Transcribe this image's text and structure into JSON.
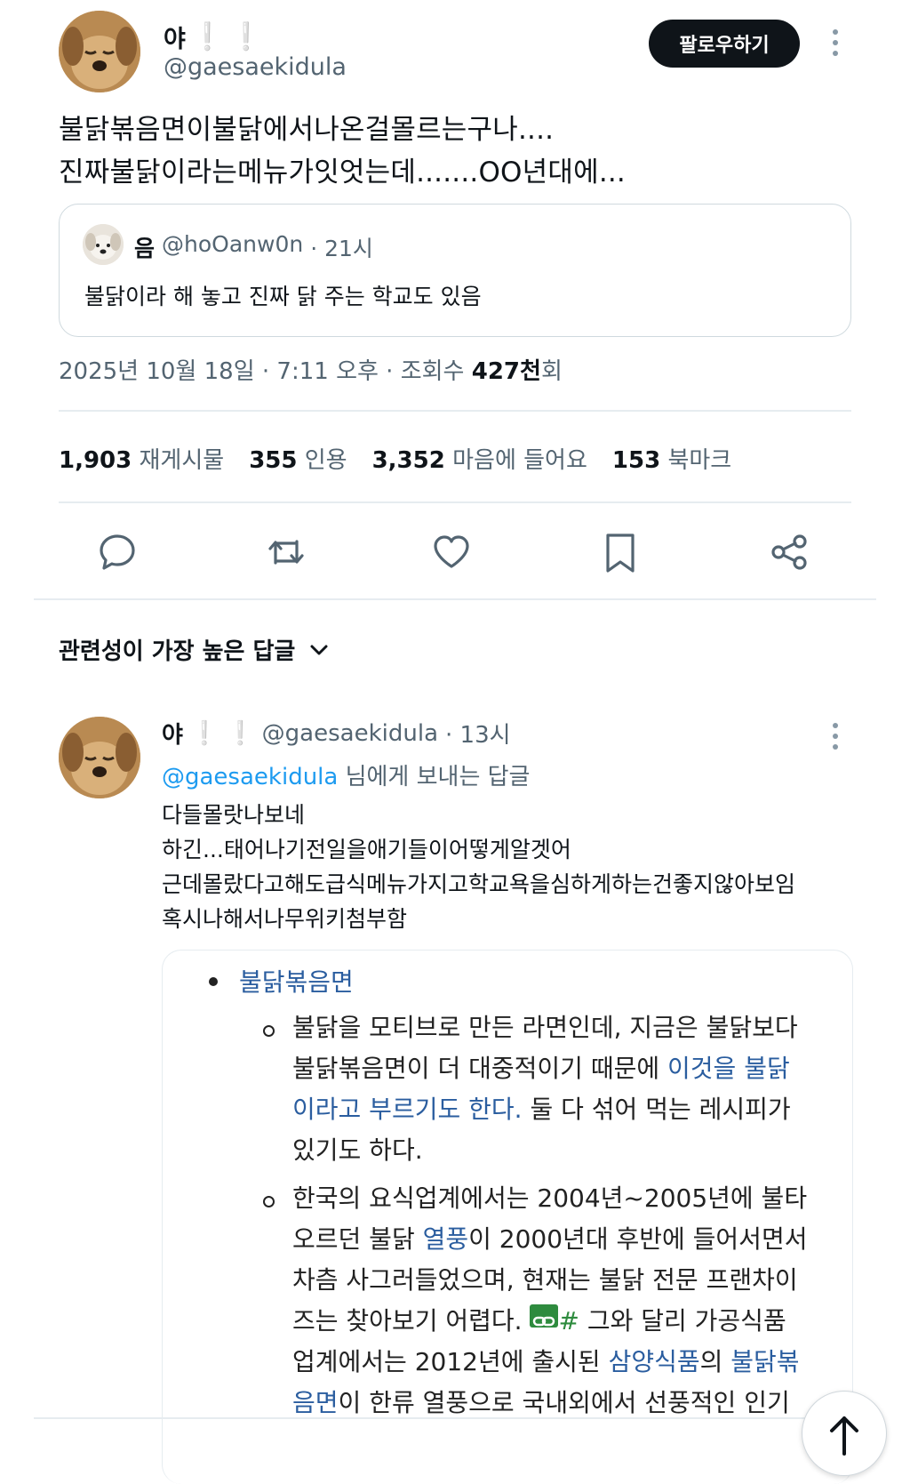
{
  "tweet": {
    "author_name": "야",
    "author_handle": "@gaesaekidula",
    "follow_label": "팔로우하기",
    "text_line1": "불닭볶음면이불닭에서나온걸몰르는구나....",
    "text_line2": "진짜불닭이라는메뉴가잇엇는데.......OO년대에...",
    "quote": {
      "name": "음",
      "handle": "@hoOanw0n",
      "time": "· 21시",
      "text": "불닭이라 해 놓고 진짜 닭 주는 학교도 있음"
    },
    "meta_prefix": "2025년 10월 18일 · 7:11 오후 · 조회수 ",
    "views": "427천",
    "views_suffix": "회",
    "stats": [
      {
        "value": "1,903",
        "label": "재게시물"
      },
      {
        "value": "355",
        "label": "인용"
      },
      {
        "value": "3,352",
        "label": "마음에 들어요"
      },
      {
        "value": "153",
        "label": "북마크"
      }
    ]
  },
  "actions": {
    "icons": [
      "reply-icon",
      "repost-icon",
      "like-icon",
      "bookmark-icon",
      "share-icon"
    ]
  },
  "replies_sort_label": "관련성이 가장 높은 답글",
  "reply": {
    "author_name": "야",
    "author_handle": "@gaesaekidula",
    "time": "· 13시",
    "replying_to_handle": "@gaesaekidula",
    "replying_to_suffix": " 님에게 보내는 답글",
    "lines": [
      "다들몰랏나보네",
      "하긴...태어나기전일을애기들이어떻게알겟어",
      "근데몰랐다고해도급식메뉴가지고학교욕을심하게하는건좋지않아보임",
      "혹시나해서나무위키첨부함"
    ],
    "embed": {
      "bullet_title": "불닭볶음면",
      "p1_part1": "불닭을 모티브로 만든 라면인데, 지금은 불닭보다",
      "p1_part2": "불닭볶음면이 더 대중적이기 때문에 ",
      "p1_link1": "이것을 불닭",
      "p1_link2": "이라고 부르기도 한다.",
      "p1_part3": " 둘 다 섞어 먹는 레시피가",
      "p1_part4": "있기도 하다.",
      "p2_l1": "한국의 요식업계에서는 2004년~2005년에 불타",
      "p2_l2a": "오르던 불닭 ",
      "p2_l2link": "열풍",
      "p2_l2b": "이 2000년대 후반에 들어서면서",
      "p2_l3": "차츰 사그러들었으며, 현재는 불닭 전문 프랜차이",
      "p2_l4a": "즈는 찾아보기 어렵다. ",
      "p2_l4hash": "#",
      "p2_l4b": " 그와 달리 가공식품",
      "p2_l5a": "업계에서는 2012년에 출시된 ",
      "p2_l5link1": "삼양식품",
      "p2_l5b": "의 ",
      "p2_l5link2": "불닭볶",
      "p2_l6link": "음면",
      "p2_l6b": "이 한류 열풍으로 국내외에서 선풍적인 인기"
    }
  },
  "colors": {
    "link": "#2a5d9f",
    "twitter_link": "#1d9bf0",
    "text": "#0f1419",
    "secondary": "#536471"
  }
}
